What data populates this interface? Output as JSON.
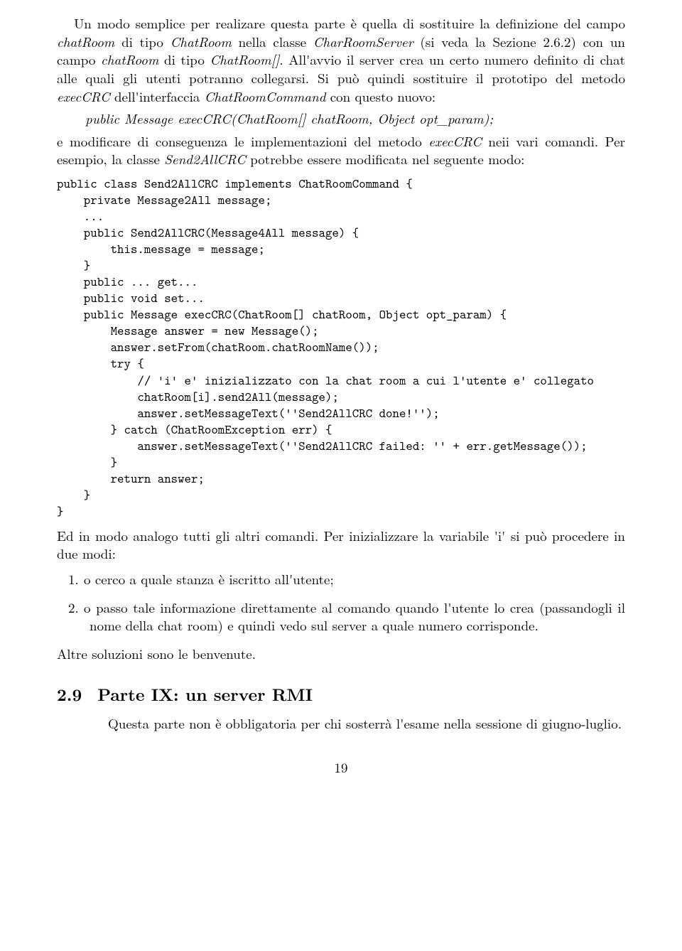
{
  "para1": {
    "t1": "Un modo semplice per realizare questa parte è quella di sostituire la definizione del campo ",
    "i1": "chatRoom",
    "t2": " di tipo ",
    "i2": "ChatRoom",
    "t3": " nella classe ",
    "i3": "CharRoomServer",
    "t4": " (si veda la Sezione 2.6.2) con un campo ",
    "i4": "chatRoom",
    "t5": " di tipo ",
    "i5": "ChatRoom[]",
    "t6": ". All'avvio il server crea un certo numero definito di chat alle quali gli utenti potranno collegarsi. Si può quindi sostituire il prototipo del metodo ",
    "i6": "execCRC",
    "t7": " dell'interfaccia ",
    "i7": "ChatRoomCommand",
    "t8": " con questo nuovo:"
  },
  "proto": "public Message execCRC(ChatRoom[] chatRoom, Object opt_param);",
  "para2": {
    "t1": "e modificare di conseguenza le implementazioni del metodo ",
    "i1": "execCRC",
    "t2": " neii vari comandi. Per esempio, la classe ",
    "i2": "Send2AllCRC",
    "t3": " potrebbe essere modificata nel seguente modo:"
  },
  "code": "public class Send2AllCRC implements ChatRoomCommand {\n    private Message2All message;\n    ...\n    public Send2AllCRC(Message4All message) {\n        this.message = message;\n    }\n    public ... get...\n    public void set...\n    public Message execCRC(ChatRoom[] chatRoom, Object opt_param) {\n        Message answer = new Message();\n        answer.setFrom(chatRoom.chatRoomName());\n        try {\n            // 'i' e' inizializzato con la chat room a cui l'utente e' collegato\n            chatRoom[i].send2All(message);\n            answer.setMessageText(''Send2AllCRC done!'');\n        } catch (ChatRoomException err) {\n            answer.setMessageText(''Send2AllCRC failed: '' + err.getMessage());\n        }\n        return answer;\n    }\n}",
  "para3": "Ed in modo analogo tutti gli altri comandi. Per inizializzare la variabile 'i' si può procedere in due modi:",
  "list": {
    "n1": "1.",
    "l1": "o cerco a quale stanza è iscritto all'utente;",
    "n2": "2.",
    "l2": "o passo tale informazione direttamente al comando quando l'utente lo crea (passandogli il nome della chat room) e quindi vedo sul server a quale numero corrisponde."
  },
  "para4": "Altre soluzioni sono le benvenute.",
  "section": {
    "num": "2.9",
    "title": "Parte IX: un server RMI",
    "body": "Questa parte non è obbligatoria per chi sosterrà l'esame nella sessione di giugno-luglio."
  },
  "pagenum": "19"
}
